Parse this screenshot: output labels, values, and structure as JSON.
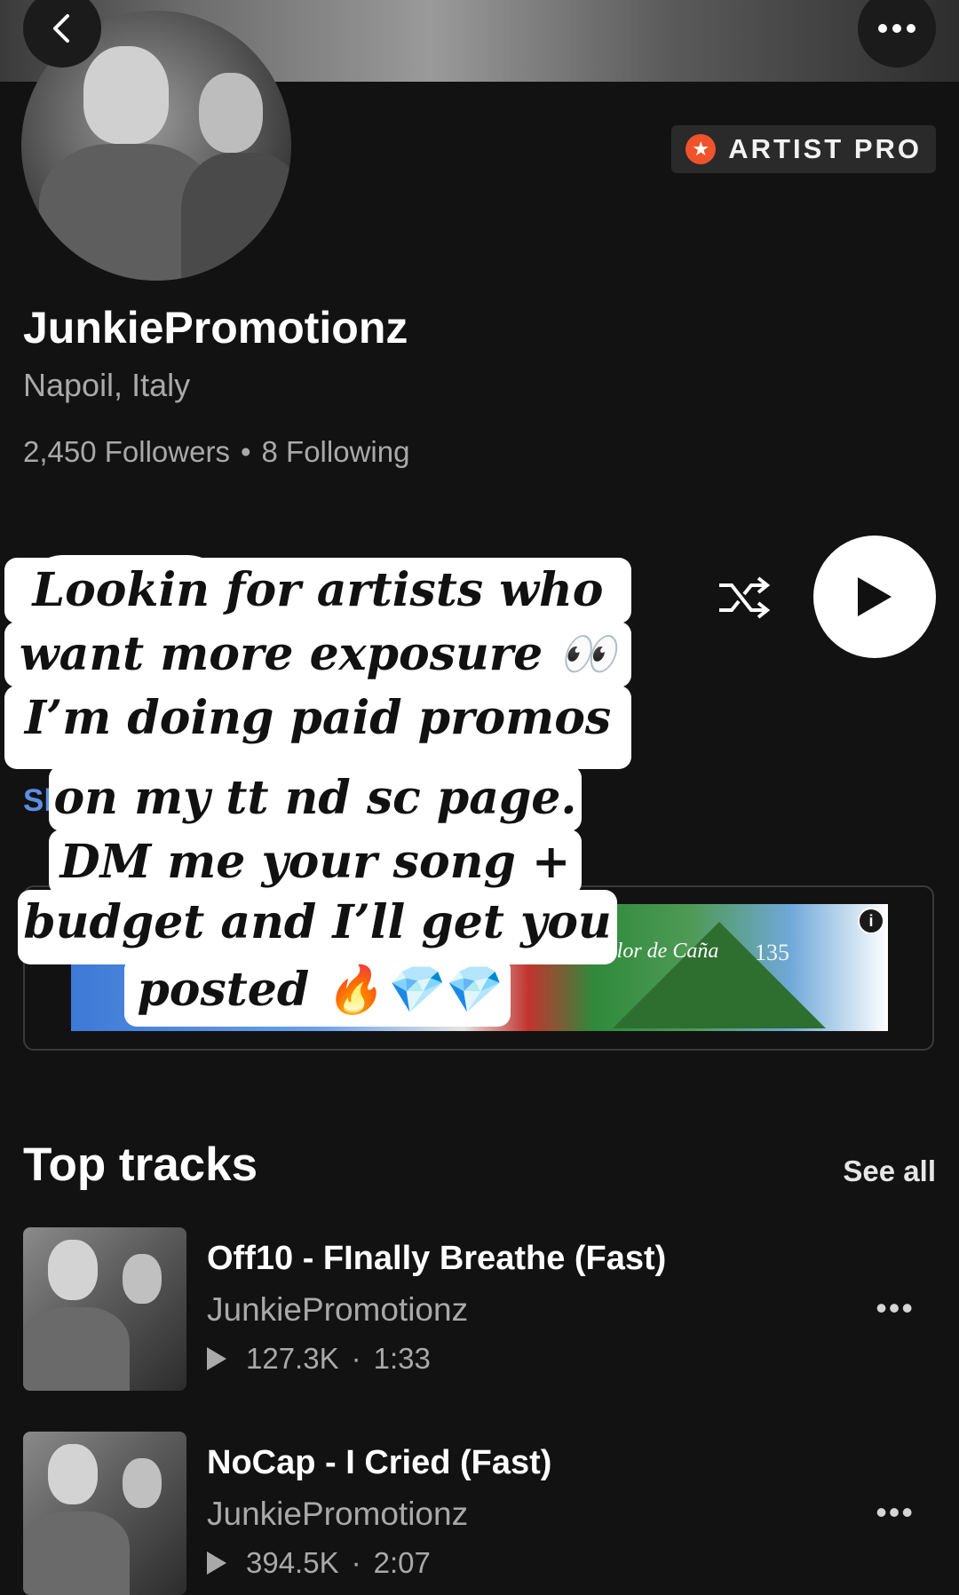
{
  "header": {
    "back_icon": "chevron-left-icon",
    "more_icon": "more-horizontal-icon"
  },
  "profile": {
    "badge_label": "ARTIST PRO",
    "name": "JunkiePromotionz",
    "location": "Napoil, Italy",
    "followers": "2,450 Followers",
    "separator": "•",
    "following": "8 Following",
    "show_link_partial": "Sh"
  },
  "controls": {
    "shuffle_icon": "shuffle-icon",
    "play_icon": "play-icon"
  },
  "caption": {
    "lines": [
      "Lookin for artists who",
      "want more exposure 👀",
      "I’m doing paid promos",
      "on my tt nd sc page.",
      "DM me your song +",
      "budget and I’ll get you",
      "posted 🔥💎💎"
    ]
  },
  "ad": {
    "brand_text": "Flor de Caña",
    "number": "135",
    "info_symbol": "i"
  },
  "top_tracks": {
    "title": "Top tracks",
    "see_all": "See all",
    "items": [
      {
        "title": "Off10 - FInally Breathe (Fast)",
        "artist": "JunkiePromotionz",
        "plays": "127.3K",
        "duration": "1:33",
        "dot": "·",
        "more": "•••"
      },
      {
        "title": "NoCap - I Cried (Fast)",
        "artist": "JunkiePromotionz",
        "plays": "394.5K",
        "duration": "2:07",
        "dot": "·",
        "more": "•••"
      }
    ]
  },
  "colors": {
    "background": "#121212",
    "accent": "#f0532c",
    "link": "#5b8ee6"
  }
}
